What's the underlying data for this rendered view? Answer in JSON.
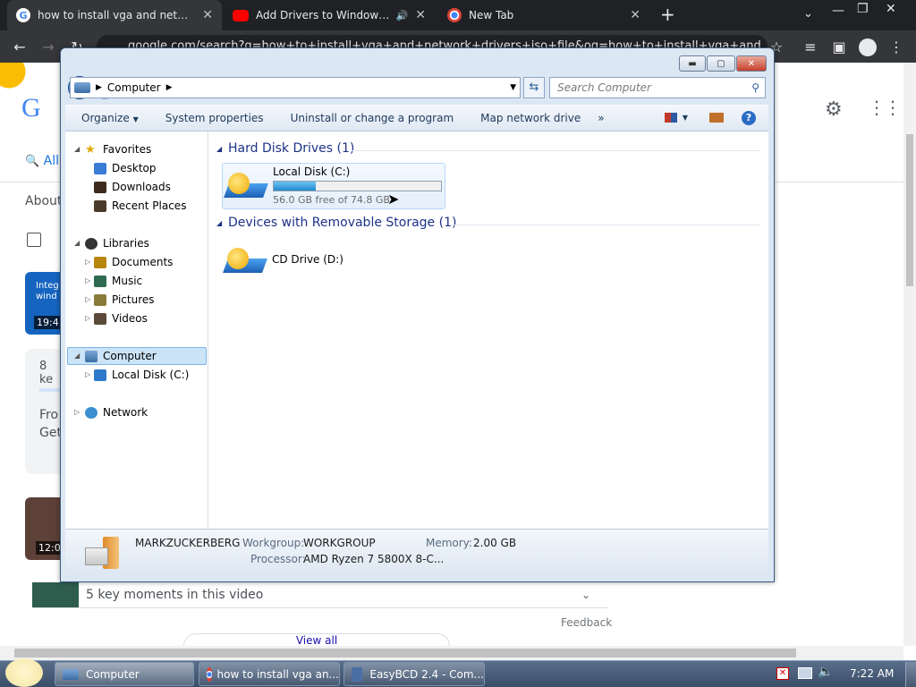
{
  "browser": {
    "tabs": [
      {
        "title": "how to install vga and network d",
        "icon": "google-icon"
      },
      {
        "title": "Add Drivers to Windows Inst",
        "icon": "youtube-icon"
      },
      {
        "title": "New Tab",
        "icon": "chrome-icon"
      }
    ],
    "new_tab_label": "+",
    "url": "google.com/search?q=how+to+install+vga+and+network+drivers+iso+file&oq=how+to+install+vga+and"
  },
  "google_page": {
    "tab_all": "All",
    "about_text": "About",
    "video_duration_1": "19:4",
    "video_thumb_text": "Integ wind",
    "key_moments_short": "8 ke",
    "snippet_line_1": "Fro",
    "snippet_line_2": "Get",
    "video_duration_2": "12:0",
    "key_moments": "5 key moments in this video",
    "feedback": "Feedback",
    "view_all": "View all"
  },
  "explorer": {
    "address_segment": "Computer",
    "search_placeholder": "Search Computer",
    "commands": [
      "Organize",
      "System properties",
      "Uninstall or change a program",
      "Map network drive",
      "»"
    ],
    "nav": {
      "favorites": "Favorites",
      "desktop": "Desktop",
      "downloads": "Downloads",
      "recent": "Recent Places",
      "libraries": "Libraries",
      "documents": "Documents",
      "music": "Music",
      "pictures": "Pictures",
      "videos": "Videos",
      "computer": "Computer",
      "local_disk": "Local Disk (C:)",
      "network": "Network"
    },
    "groups": {
      "hdd": "Hard Disk Drives (1)",
      "removable": "Devices with Removable Storage (1)"
    },
    "drives": {
      "c_name": "Local Disk (C:)",
      "c_free": "56.0 GB free of 74.8 GB",
      "c_used_fraction": 0.25,
      "d_name": "CD Drive (D:)"
    },
    "details": {
      "computer_name": "MARKZUCKERBERG",
      "workgroup_label": "Workgroup:",
      "workgroup": "WORKGROUP",
      "memory_label": "Memory:",
      "memory": "2.00 GB",
      "processor_label": "Processor:",
      "processor": "AMD Ryzen 7 5800X 8-C..."
    }
  },
  "taskbar": {
    "items": [
      "Computer",
      "how to install vga an...",
      "EasyBCD 2.4 - Com..."
    ],
    "clock": "7:22 AM"
  },
  "colors": {
    "chrome_dark": "#202124",
    "explorer_frame": "#dce7f4",
    "group_header": "#1e3287",
    "progress": "#26a0da"
  }
}
